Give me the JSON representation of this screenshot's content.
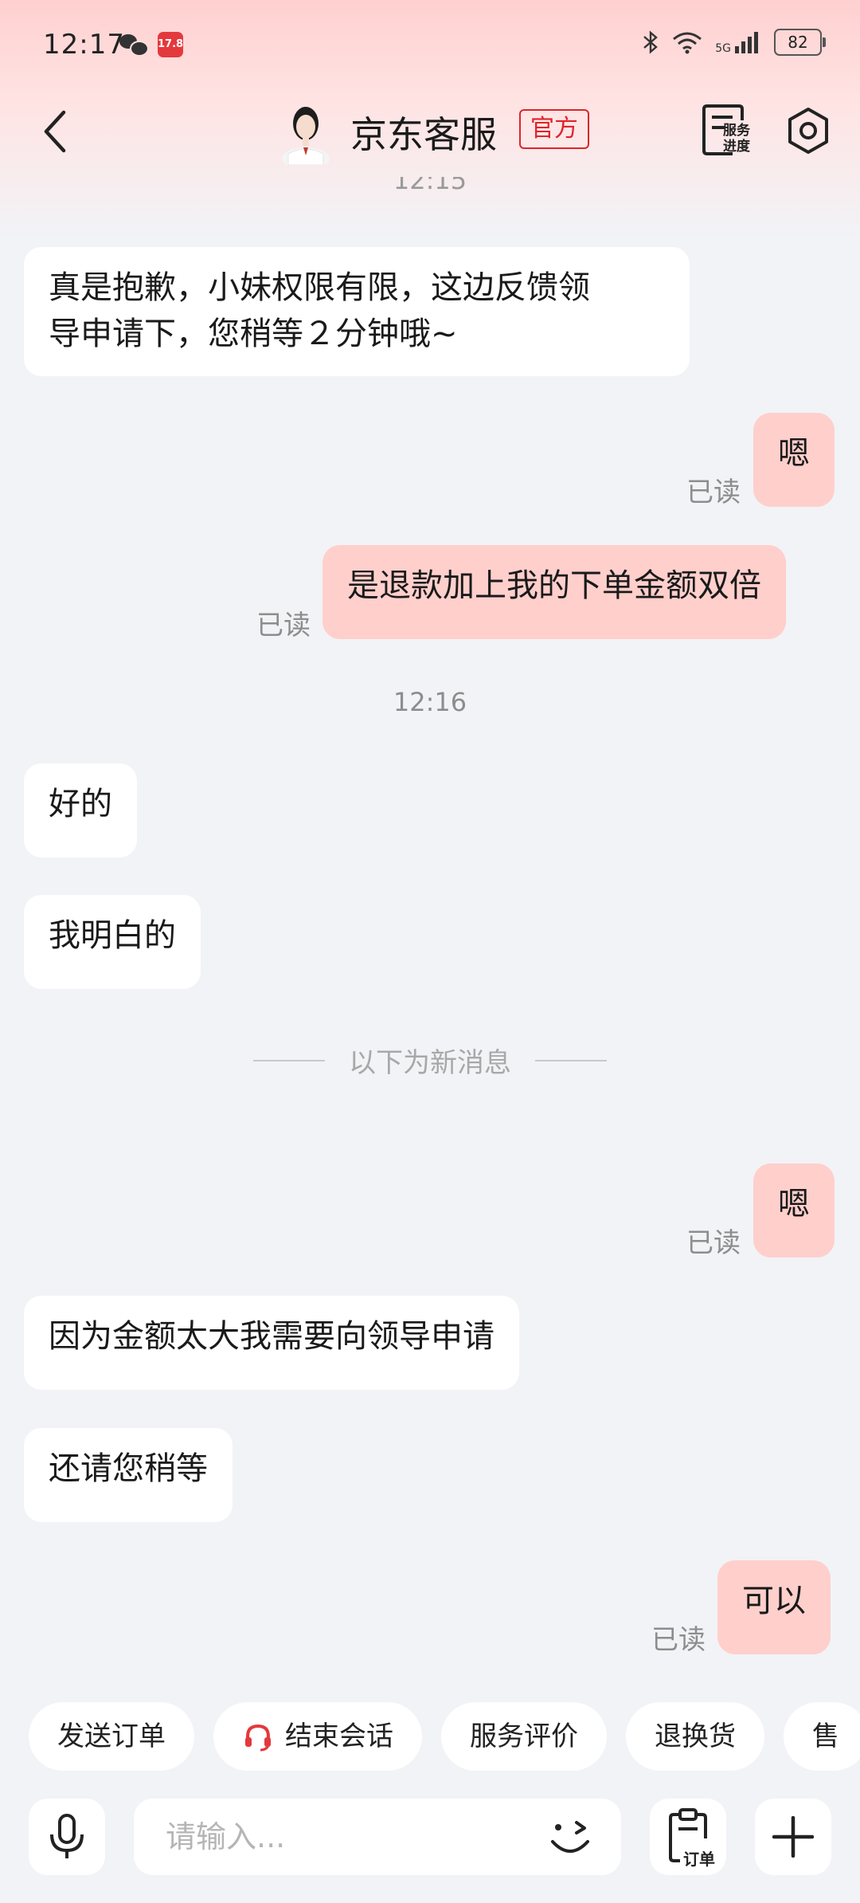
{
  "status_bar": {
    "time": "12:17",
    "battery": "82",
    "network": "5G",
    "notification_badge": "17.8"
  },
  "header": {
    "title": "京东客服",
    "badge": "官方",
    "service_progress_label_line1": "服务",
    "service_progress_label_line2": "进度"
  },
  "chat": {
    "partial_timestamp": "12:15",
    "messages": [
      {
        "side": "left",
        "text_line1": "真是抱歉，小妹权限有限，这边反馈领",
        "text_line2": "导申请下，您稍等２分钟哦~"
      },
      {
        "side": "right",
        "text": "嗯",
        "status": "已读"
      },
      {
        "side": "right",
        "text": "是退款加上我的下单金额双倍",
        "status": "已读"
      },
      {
        "timestamp": "12:16"
      },
      {
        "side": "left",
        "text": "好的"
      },
      {
        "side": "left",
        "text": "我明白的"
      },
      {
        "divider": "以下为新消息"
      },
      {
        "side": "right",
        "text": "嗯",
        "status": "已读"
      },
      {
        "side": "left",
        "text": "因为金额太大我需要向领导申请"
      },
      {
        "side": "left",
        "text": "还请您稍等"
      },
      {
        "side": "right",
        "text": "可以",
        "status": "已读"
      }
    ]
  },
  "quick_actions": [
    {
      "label": "发送订单"
    },
    {
      "label": "结束会话",
      "icon": "headset-icon"
    },
    {
      "label": "服务评价"
    },
    {
      "label": "退换货"
    },
    {
      "label": "售"
    }
  ],
  "input": {
    "placeholder": "请输入...",
    "order_label": "订单"
  },
  "colors": {
    "accent": "#e0242a",
    "bubble_sent": "#ffcfcc",
    "bubble_received": "#ffffff",
    "background": "#f2f3f7"
  }
}
